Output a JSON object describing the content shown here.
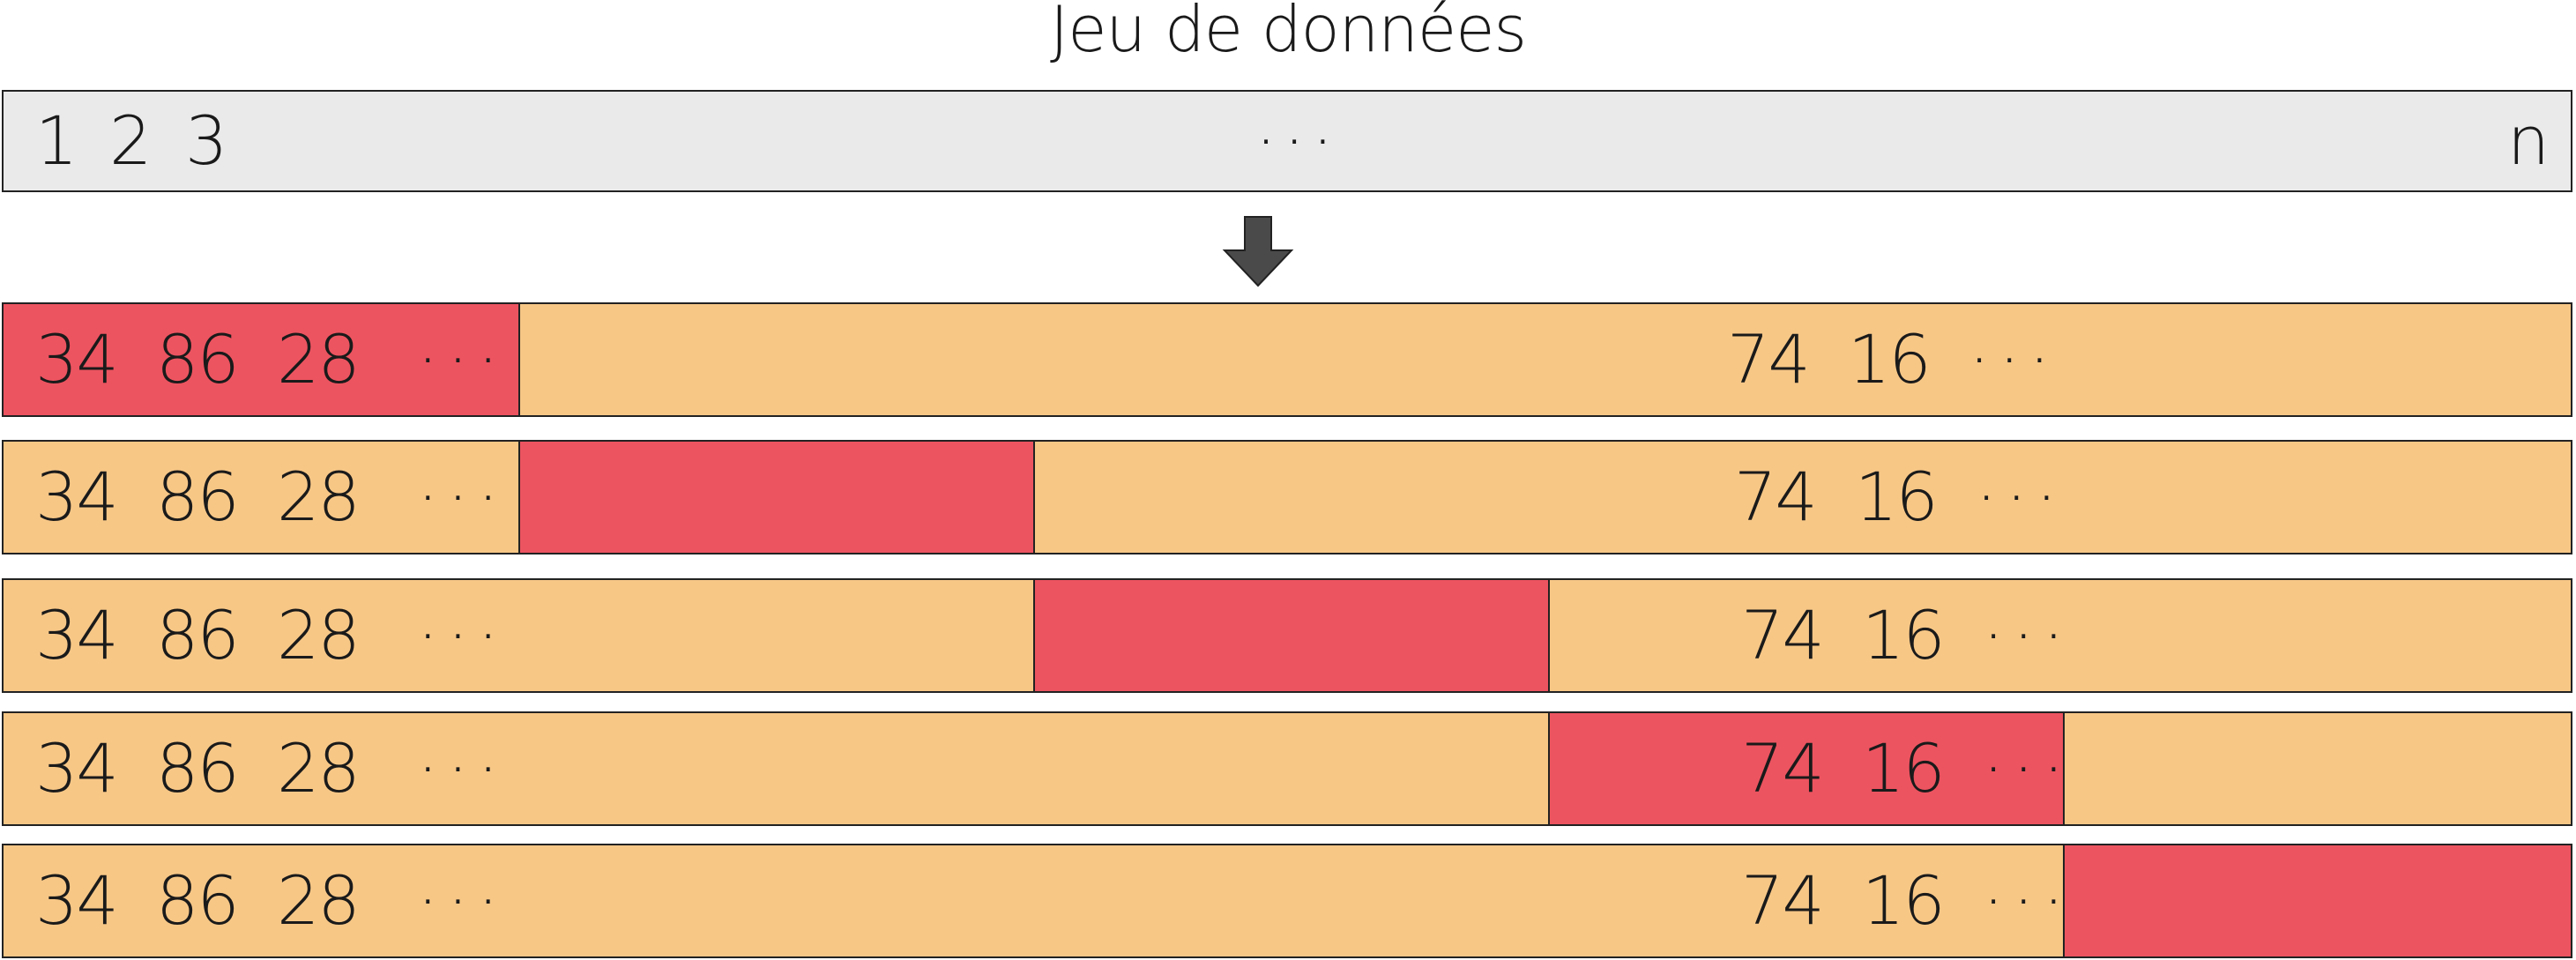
{
  "title": "Jeu de données",
  "dataset": {
    "first": "1",
    "second": "2",
    "third": "3",
    "middle": "···",
    "last": "n"
  },
  "arrow_icon": "down-arrow-icon",
  "colors": {
    "dataset_bg": "#eaeaea",
    "train": "#f7c786",
    "test": "#ec5460",
    "arrow": "#4a4a4a"
  },
  "folds": [
    {
      "test_fold": 1,
      "left_values": "34  86  28",
      "left_dots": "···",
      "right_values": "74  16",
      "right_dots": "···"
    },
    {
      "test_fold": 2,
      "left_values": "34  86  28",
      "left_dots": "···",
      "right_values": "74  16",
      "right_dots": "···"
    },
    {
      "test_fold": 3,
      "left_values": "34  86  28",
      "left_dots": "···",
      "right_values": "74  16",
      "right_dots": "···"
    },
    {
      "test_fold": 4,
      "left_values": "34  86  28",
      "left_dots": "···",
      "right_values": "74  16",
      "right_dots": "···"
    },
    {
      "test_fold": 5,
      "left_values": "34  86  28",
      "left_dots": "···",
      "right_values": "74  16",
      "right_dots": "···"
    }
  ]
}
